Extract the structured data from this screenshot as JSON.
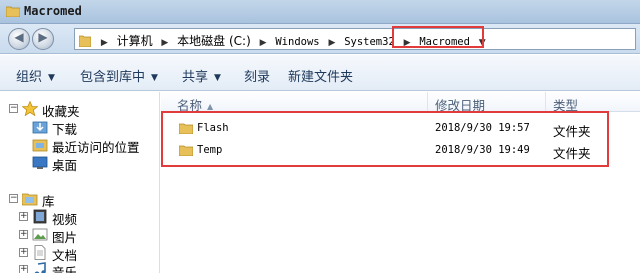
{
  "window": {
    "title": "Macromed"
  },
  "address": {
    "crumbs": [
      {
        "label": "计算机",
        "mono": false
      },
      {
        "label": "本地磁盘 (C:)",
        "mono": false
      },
      {
        "label": "Windows",
        "mono": true
      },
      {
        "label": "System32",
        "mono": true
      },
      {
        "label": "Macromed",
        "mono": true
      }
    ]
  },
  "toolbar": {
    "organize": "组织",
    "include_in_library": "包含到库中",
    "share": "共享",
    "burn": "刻录",
    "new_folder": "新建文件夹"
  },
  "nav": {
    "favorites": "收藏夹",
    "downloads": "下载",
    "recent": "最近访问的位置",
    "desktop": "桌面",
    "libraries": "库",
    "videos": "视频",
    "pictures": "图片",
    "documents": "文档",
    "music": "音乐"
  },
  "columns": {
    "name": "名称",
    "modified": "修改日期",
    "type": "类型"
  },
  "files": [
    {
      "name": "Flash",
      "modified": "2018/9/30 19:57",
      "type": "文件夹"
    },
    {
      "name": "Temp",
      "modified": "2018/9/30 19:49",
      "type": "文件夹"
    }
  ],
  "colors": {
    "highlight": "#e23b3b",
    "folder": "#e8c05a",
    "toolbar_text": "#1e395b"
  }
}
